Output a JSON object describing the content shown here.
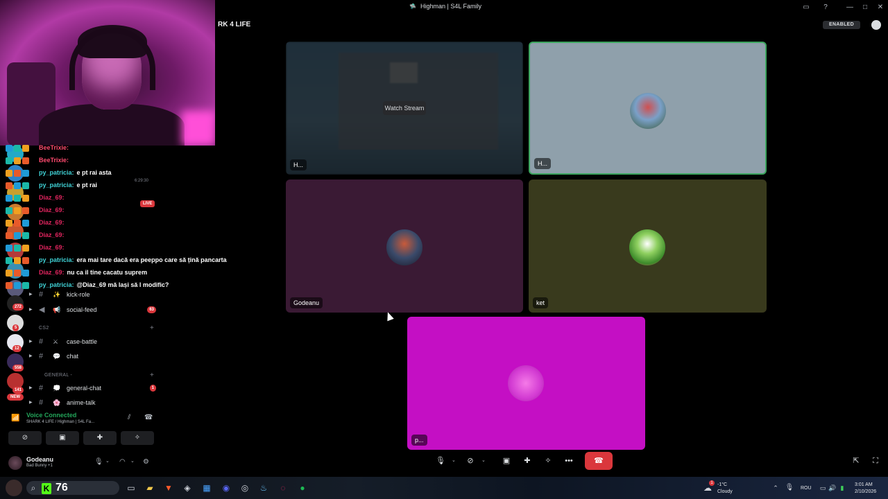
{
  "window": {
    "title": "Highman | S4L Family"
  },
  "header": {
    "server_name": "RK 4 LIFE",
    "enabled_badge": "ENABLED"
  },
  "chat_overlay": [
    {
      "user": "BeeTrixie:",
      "message": "",
      "user_color": "#ff4a6e"
    },
    {
      "user": "BeeTrixie:",
      "message": "",
      "user_color": "#ff4a6e"
    },
    {
      "user": "py_patricia:",
      "message": "e pt rai asta",
      "user_color": "#3fd0d4"
    },
    {
      "user": "py_patricia:",
      "message": "e pt rai",
      "user_color": "#3fd0d4"
    },
    {
      "user": "Diaz_69:",
      "message": "",
      "user_color": "#e0245e"
    },
    {
      "user": "Diaz_69:",
      "message": "",
      "user_color": "#e0245e"
    },
    {
      "user": "Diaz_69:",
      "message": "",
      "user_color": "#e0245e"
    },
    {
      "user": "Diaz_69:",
      "message": "",
      "user_color": "#e0245e"
    },
    {
      "user": "Diaz_69:",
      "message": "",
      "user_color": "#e0245e"
    },
    {
      "user": "py_patricia:",
      "message": "era mai tare dacă era peeppo care să țină pancarta",
      "user_color": "#3fd0d4"
    },
    {
      "user": "Diaz_69:",
      "message": "nu ca il tine cacatu suprem",
      "user_color": "#e0245e"
    },
    {
      "user": "py_patricia:",
      "message": "@Diaz_69 mă lași să l modific?",
      "user_color": "#3fd0d4"
    }
  ],
  "sidebar": {
    "stream_time": "6:29:30",
    "live_badge": "LIVE",
    "server_badges": [
      "272",
      "5",
      "12",
      "558",
      "141",
      "NEW"
    ],
    "channels": [
      {
        "name": "kick-role",
        "emoji": "✨",
        "count": ""
      },
      {
        "name": "social-feed",
        "emoji": "📢",
        "count": "63"
      },
      {
        "name": "case-battle",
        "emoji": "⚔",
        "count": ""
      },
      {
        "name": "chat",
        "emoji": "💬",
        "count": ""
      },
      {
        "name": "general-chat",
        "emoji": "💭",
        "count": "1"
      },
      {
        "name": "anime-talk",
        "emoji": "🌸",
        "count": ""
      }
    ],
    "categories": [
      "CS2",
      "GENERAL - "
    ]
  },
  "voice": {
    "status": "Voice Connected",
    "channel": "SHARK 4 LIFE / Highman | S4L Fa..."
  },
  "user": {
    "name": "Godeanu",
    "status": "Bad Bunny +1"
  },
  "stage": {
    "watch_label": "Watch Stream",
    "tiles": [
      {
        "label": "H...",
        "bg": "#1d2a33"
      },
      {
        "label": "H...",
        "bg": "#8fa0ab"
      },
      {
        "label": "Godeanu",
        "bg": "#3a1a34"
      },
      {
        "label": "ket",
        "bg": "#393a1d"
      },
      {
        "label": "p...",
        "bg": "#c40fc4"
      }
    ]
  },
  "taskbar": {
    "score": "76",
    "weather_temp": "-1°C",
    "weather_desc": "Cloudy",
    "lang": "ROU",
    "time": "3:01 AM",
    "date": "2/10/2026",
    "weather_alert": "1"
  },
  "colors": {
    "accent_green": "#23a55a",
    "danger_red": "#da373c",
    "speaking_border": "#3ba55d"
  }
}
